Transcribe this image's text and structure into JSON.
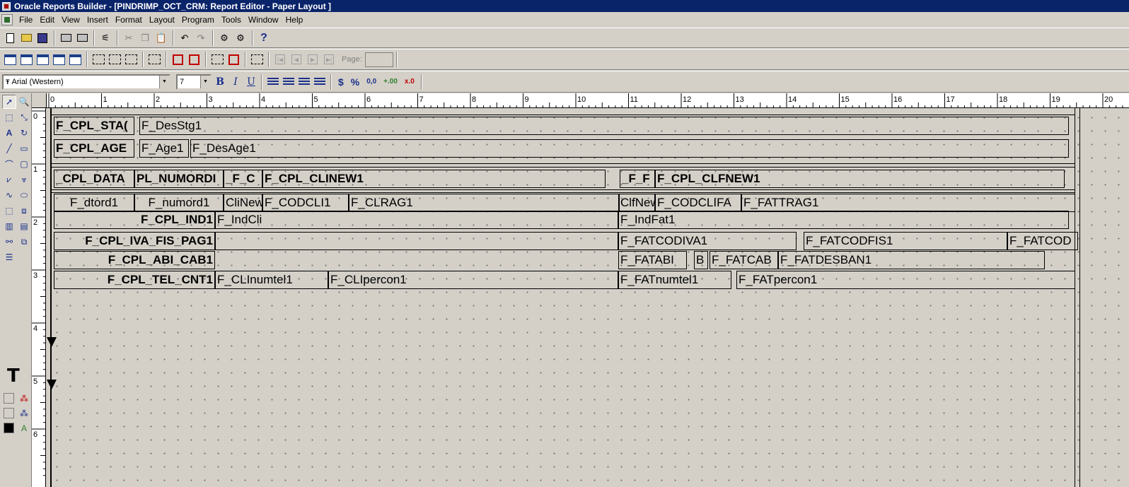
{
  "window": {
    "title": "Oracle Reports Builder - [PINDRIMP_OCT_CRM: Report Editor - Paper Layout ]"
  },
  "menu": [
    {
      "label": "File"
    },
    {
      "label": "Edit"
    },
    {
      "label": "View"
    },
    {
      "label": "Insert"
    },
    {
      "label": "Format"
    },
    {
      "label": "Layout"
    },
    {
      "label": "Program"
    },
    {
      "label": "Tools"
    },
    {
      "label": "Window"
    },
    {
      "label": "Help"
    }
  ],
  "toolbar": {
    "help_glyph": "?",
    "page_label": "Page:",
    "page_value": ""
  },
  "format_bar": {
    "font": "Arial (Western)",
    "size": "7",
    "bold": "B",
    "italic": "I",
    "underline": "U",
    "currency": "$",
    "percent": "%",
    "commas": "0,0",
    "add_decimal": "+.00",
    "remove_decimal": "x.0"
  },
  "palette": {
    "text_tool": "T"
  },
  "ruler": {
    "h_labels": [
      "0",
      "1",
      "2",
      "3",
      "4",
      "5",
      "6",
      "7",
      "8",
      "9",
      "10",
      "11",
      "12",
      "13",
      "14",
      "15",
      "16",
      "17",
      "18",
      "19",
      "20"
    ],
    "v_labels": [
      "0",
      "1",
      "2",
      "3",
      "4",
      "5",
      "6"
    ]
  },
  "fields": {
    "f_cpl_stag": "F_CPL_STA(",
    "f_desstg1": "F_DesStg1",
    "f_cpl_age": "F_CPL_AGE",
    "f_age1": "F_Age1",
    "f_desage1": "F_DesAge1",
    "h_cpl_data": "_CPL_DATA",
    "h_pl_numordi": "PL_NUMORDI",
    "h_f_c": "_F_C",
    "h_cpl_clinew1": "F_CPL_CLINEW1",
    "h_f_f": "_F_F",
    "h_cpl_clfnew1": "F_CPL_CLFNEW1",
    "f_dtord1": "F_dtord1",
    "f_numord1": "F_numord1",
    "f_clinew": "CliNew",
    "f_codcli1": "F_CODCLI1",
    "f_clrag1": "F_CLRAG1",
    "f_clfnew": "ClfNew",
    "f_codclifa": "F_CODCLIFA",
    "f_fattrag1": "F_FATTRAG1",
    "f_cpl_ind1": "F_CPL_IND1",
    "f_indcli": "F_IndCli",
    "f_indfat1": "F_IndFat1",
    "f_cpl_iva_fis_pag1": "F_CPL_IVA_FIS_PAG1",
    "f_fatcodiva1": "F_FATCODIVA1",
    "f_fatcodfis1": "F_FATCODFIS1",
    "f_fatcod": "F_FATCOD",
    "f_cpl_abi_cab1": "F_CPL_ABI_CAB1",
    "f_fatabi": "F_FATABI",
    "f_b": "B",
    "f_fatcab": "F_FATCAB",
    "f_fatdesban1": "F_FATDESBAN1",
    "f_cpl_tel_cnt1": "F_CPL_TEL_CNT1",
    "f_clinumtel1": "F_CLInumtel1",
    "f_clipercon1": "F_CLIpercon1",
    "f_fatnumtel1": "F_FATnumtel1",
    "f_fatpercon1": "F_FATpercon1"
  },
  "colors": {
    "title_bar": "#0a246a",
    "chrome": "#d4d0c8",
    "accent_blue": "#1a2f8a",
    "fill_swatch": "#000000"
  }
}
